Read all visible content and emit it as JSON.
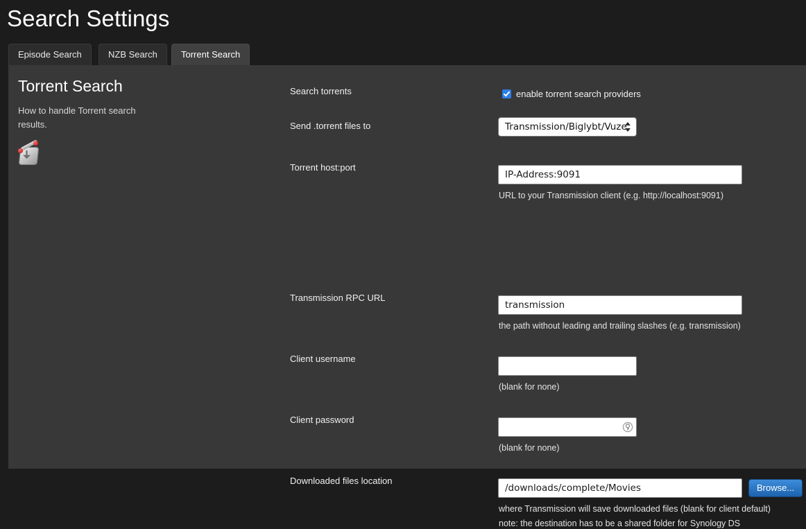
{
  "header": {
    "title": "Search Settings"
  },
  "tabs": [
    {
      "id": "episode-search",
      "label": "Episode Search",
      "active": false
    },
    {
      "id": "nzb-search",
      "label": "NZB Search",
      "active": false
    },
    {
      "id": "torrent-search",
      "label": "Torrent Search",
      "active": true
    }
  ],
  "sidebar": {
    "title": "Torrent Search",
    "description": "How to handle Torrent search results.",
    "icon": "transmission-icon"
  },
  "form": {
    "rows": [
      {
        "id": "search-torrents",
        "label": "Search torrents",
        "type": "checkbox",
        "checked": true,
        "checkbox_label": "enable torrent search providers",
        "help": ""
      },
      {
        "id": "send-torrent-files-to",
        "label": "Send .torrent files to",
        "type": "select",
        "value": "Transmission/Biglybt/Vuze",
        "help": ""
      },
      {
        "id": "torrent-host-port",
        "label": "Torrent host:port",
        "type": "text",
        "value": "IP-Address:9091",
        "placeholder": "IP-Address:9091",
        "help": "URL to your Transmission client (e.g. http://localhost:9091)"
      },
      {
        "id": "transmission-rpc-url",
        "label": "Transmission RPC URL",
        "type": "text",
        "value": "transmission",
        "placeholder": "transmission",
        "help": "the path without leading and trailing slashes (e.g. transmission)"
      },
      {
        "id": "client-username",
        "label": "Client username",
        "type": "text",
        "value": "",
        "placeholder": "",
        "help": "(blank for none)"
      },
      {
        "id": "client-password",
        "label": "Client password",
        "type": "password",
        "value": "",
        "placeholder": "",
        "help": "(blank for none)",
        "icon": "key-icon"
      },
      {
        "id": "downloaded-files-location",
        "label": "Downloaded files location",
        "type": "text-with-button",
        "value": "/downloads/complete/Movies",
        "placeholder": "/downloads/complete/Movies",
        "button_label": "Browse...",
        "help": "where Transmission will save downloaded files (blank for client default)",
        "help2": "note: the destination has to be a shared folder for Synology DS"
      }
    ]
  },
  "colors": {
    "page_bg": "#1c1c1c",
    "panel_bg": "#383838",
    "tab_bg": "#2c2c2c",
    "tab_active_bg": "#404040",
    "accent_blue": "#2b7fe8",
    "button_blue": "#1d63ae",
    "text": "#ffffff"
  }
}
